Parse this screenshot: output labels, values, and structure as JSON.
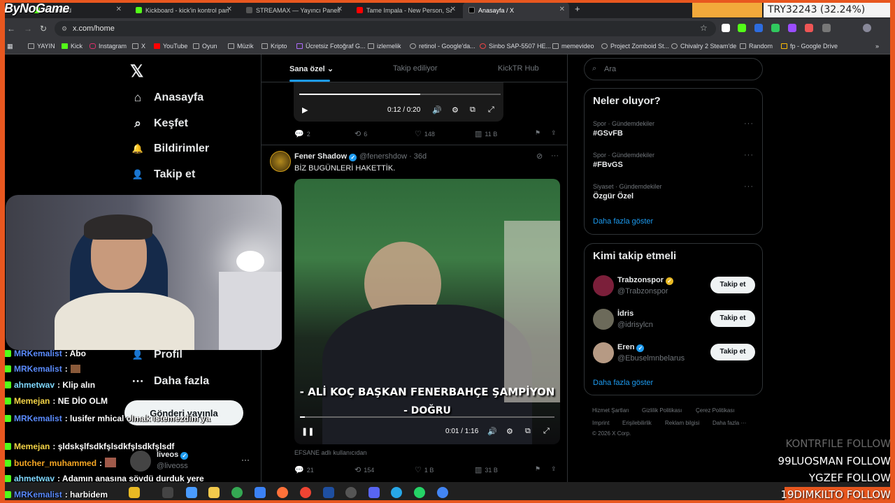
{
  "browser": {
    "tabs": [
      {
        "label": "Kickboard"
      },
      {
        "label": "Kickboard - kick'in kontrol pan..."
      },
      {
        "label": "STREAMAX — Yayıncı Paneli"
      },
      {
        "label": "Tame Impala - New Person, Sam..."
      },
      {
        "label": "Anasayfa / X"
      }
    ],
    "new_tab": "+",
    "url": "x.com/home",
    "bookmarks": [
      "YAYIN",
      "Kick",
      "Instagram",
      "X",
      "YouTube",
      "Oyun",
      "Müzik",
      "Kripto",
      "Ücretsiz Fotoğraf G...",
      "izlemelik",
      "retinol - Google'da...",
      "Sinbo SAP-5507 HE...",
      "memevideo",
      "Project Zomboid St...",
      "Chivalry 2 Steam'de",
      "Random",
      "fp - Google Drive"
    ]
  },
  "overlay": {
    "brand": "ByNoGame",
    "currency": "TRY32243 (32.24%)"
  },
  "nav": {
    "logo": "𝕏",
    "items": [
      {
        "label": "Anasayfa",
        "icon": "home-icon",
        "glyph": "⌂"
      },
      {
        "label": "Keşfet",
        "icon": "search-icon",
        "glyph": "⌕"
      },
      {
        "label": "Bildirimler",
        "icon": "bell-icon",
        "glyph": "🔔"
      },
      {
        "label": "Takip et",
        "icon": "person-plus-icon",
        "glyph": "👤"
      },
      {
        "label": "Profil",
        "icon": "profile-icon",
        "glyph": "👤"
      },
      {
        "label": "Daha fazla",
        "icon": "more-icon",
        "glyph": "⋯"
      }
    ],
    "post_button": "Gönderi yayınla"
  },
  "account": {
    "name": "liveos",
    "handle": "@liveoss"
  },
  "feed": {
    "tabs": [
      "Sana özel",
      "Takip ediliyor",
      "KickTR Hub"
    ],
    "tweet1": {
      "video_time": "0:12 / 0:20",
      "replies": "2",
      "reposts": "6",
      "likes": "148",
      "views": "11 B"
    },
    "tweet2": {
      "name": "Fener Shadow",
      "handle": "@fenershdow · 36d",
      "text": "BİZ BUGÜNLERİ HAKETTİK.",
      "caption_line1": "- ALİ KOÇ BAŞKAN FENERBAHÇE ŞAMPİYON",
      "caption_line2": "- DOĞRU",
      "video_time": "0:01 / 1:16",
      "attribution": "EFSANE adlı kullanıcıdan",
      "replies": "21",
      "reposts": "154",
      "likes": "1 B",
      "views": "31 B"
    }
  },
  "sidebar": {
    "search_placeholder": "Ara",
    "trends_title": "Neler oluyor?",
    "trends": [
      {
        "category": "Spor · Gündemdekiler",
        "name": "#GSvFB"
      },
      {
        "category": "Spor · Gündemdekiler",
        "name": "#FBvGS"
      },
      {
        "category": "Siyaset · Gündemdekiler",
        "name": "Özgür Özel"
      }
    ],
    "trends_more": "Daha fazla göster",
    "wtf_title": "Kimi takip etmeli",
    "wtf": [
      {
        "name": "Trabzonspor",
        "handle": "@Trabzonspor",
        "button": "Takip et"
      },
      {
        "name": "İdris",
        "handle": "@idrisylcn",
        "button": "Takip et"
      },
      {
        "name": "Eren",
        "handle": "@Ebuselmnbelarus",
        "button": "Takip et"
      }
    ],
    "wtf_more": "Daha fazla göster",
    "footer": [
      "Hizmet Şartları",
      "Gizlilik Politikası",
      "Çerez Politikası",
      "Imprint",
      "Erişilebilirlik",
      "Reklam bilgisi",
      "Daha fazla ···",
      "© 2026 X Corp."
    ]
  },
  "chat": [
    {
      "user": "MRKemalist",
      "msg": ": Abo",
      "color": "#5b8cff"
    },
    {
      "user": "MRKemalist",
      "msg": ":",
      "color": "#5b8cff"
    },
    {
      "user": "ahmetwav",
      "msg": ": Klip alın",
      "color": "#7fd8ff"
    },
    {
      "user": "Memejan",
      "msg": ": NE DİO OLM",
      "color": "#f5d547"
    },
    {
      "user": "MRKemalist",
      "msg": ": lusifer mhical olmak istemezdim ya",
      "color": "#5b8cff"
    },
    {
      "user": "Memejan",
      "msg": ": şldskşlfsdkfşlsdkfşlsdkfşlsdf",
      "color": "#f5d547"
    },
    {
      "user": "butcher_muhammed",
      "msg": ":",
      "color": "#f5a623"
    },
    {
      "user": "ahmetwav",
      "msg": ": Adamın anasına sövdü durduk yere",
      "color": "#7fd8ff"
    },
    {
      "user": "MRKemalist",
      "msg": ": harbidem",
      "color": "#5b8cff"
    }
  ],
  "ticker": [
    "KONTRFILE FOLLOW",
    "99LUOSMAN FOLLOW",
    "YGZEF FOLLOW",
    "19DIMKILTO FOLLOW"
  ],
  "colors": {
    "accent": "#1d9bf0",
    "frame": "#e8571f",
    "kick": "#53fc18"
  }
}
